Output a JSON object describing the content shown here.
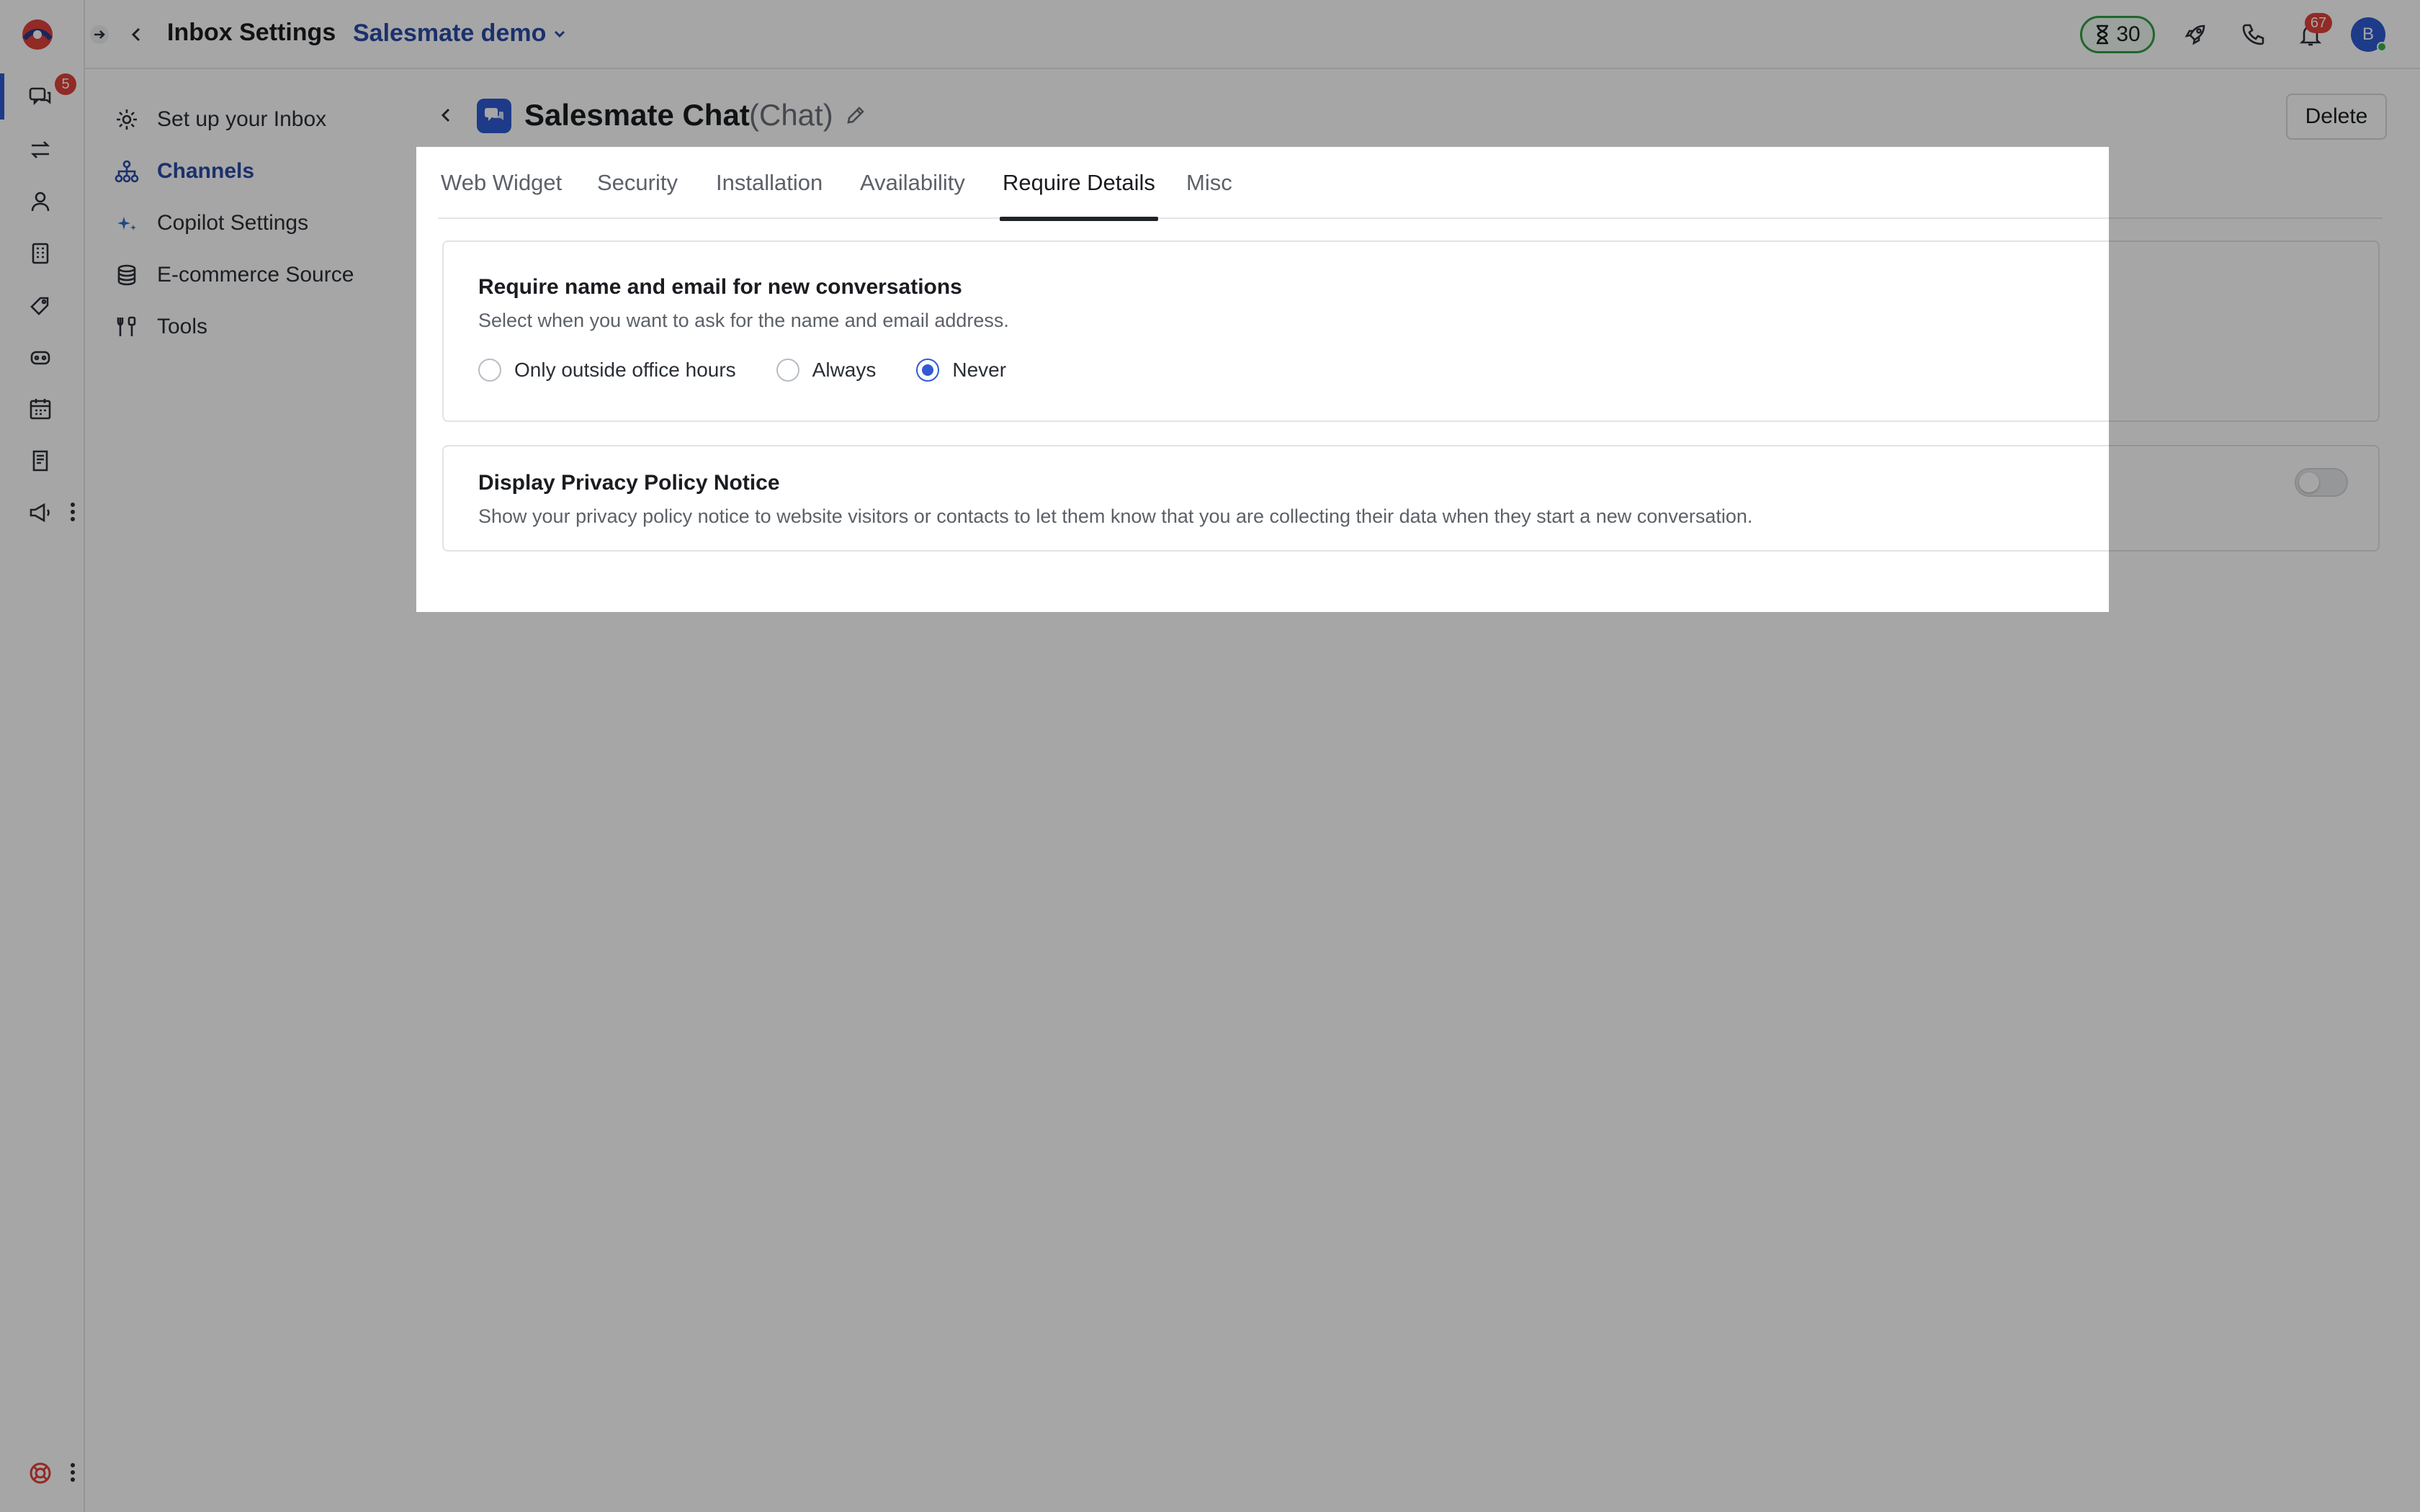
{
  "app": {
    "title": "Inbox Settings",
    "workspace": "Salesmate demo",
    "rail_conversations_badge": "5",
    "timer_value": "30",
    "notifications_badge": "67",
    "avatar_initial": "B"
  },
  "rail": {
    "items": [
      {
        "icon": "conversations-icon"
      },
      {
        "icon": "routing-icon"
      },
      {
        "icon": "contacts-icon"
      },
      {
        "icon": "companies-icon"
      },
      {
        "icon": "deals-icon"
      },
      {
        "icon": "bots-icon"
      },
      {
        "icon": "activities-icon"
      },
      {
        "icon": "notes-icon"
      },
      {
        "icon": "campaigns-icon"
      }
    ],
    "bottom_icon": "help-lifebuoy-icon"
  },
  "subnav": {
    "items": [
      {
        "label": "Set up your Inbox",
        "icon": "gear-icon"
      },
      {
        "label": "Channels",
        "icon": "channels-icon",
        "active": true
      },
      {
        "label": "Copilot Settings",
        "icon": "sparkle-icon"
      },
      {
        "label": "E-commerce Source",
        "icon": "database-icon"
      },
      {
        "label": "Tools",
        "icon": "tools-icon"
      }
    ]
  },
  "channel": {
    "name": "Salesmate Chat",
    "type": "(Chat)",
    "delete_label": "Delete"
  },
  "tabs": [
    {
      "label": "Web Widget"
    },
    {
      "label": "Security"
    },
    {
      "label": "Installation"
    },
    {
      "label": "Availability"
    },
    {
      "label": "Require Details",
      "active": true
    },
    {
      "label": "Misc"
    }
  ],
  "require_details": {
    "title": "Require name and email for new conversations",
    "subtitle": "Select when you want to ask for the name and email address.",
    "options": [
      {
        "label": "Only outside office hours",
        "checked": false
      },
      {
        "label": "Always",
        "checked": false
      },
      {
        "label": "Never",
        "checked": true
      }
    ]
  },
  "privacy_notice": {
    "title": "Display Privacy Policy Notice",
    "subtitle": "Show your privacy policy notice to website visitors or contacts to let them know that you are collecting their data when they start a new conversation.",
    "enabled": false
  },
  "colors": {
    "accent": "#2f5bd3",
    "nav_active": "#2a4ba8",
    "badge": "#e0413a",
    "timer_border": "#2f9e44"
  }
}
